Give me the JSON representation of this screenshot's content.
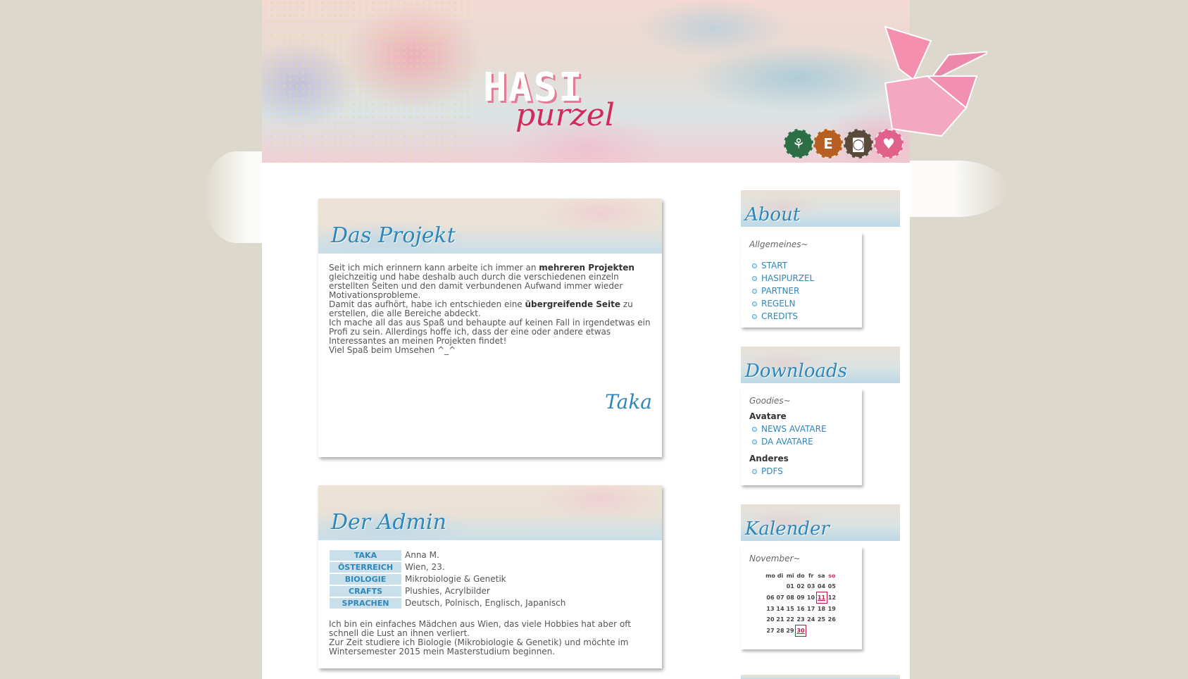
{
  "header": {
    "logo_top": "HASI",
    "logo_bottom": "purzel",
    "social": [
      {
        "icon": "deviantart-icon",
        "glyph": "⚘",
        "color": "#2e6e44"
      },
      {
        "icon": "etsy-icon",
        "glyph": "E",
        "color": "#b75f22"
      },
      {
        "icon": "instagram-icon",
        "glyph": "◙",
        "color": "#5a4a3a"
      },
      {
        "icon": "heart-icon",
        "glyph": "♥",
        "color": "#e0628a"
      }
    ]
  },
  "projekt": {
    "title": "Das Projekt",
    "p1_pre": "Seit ich mich erinnern kann arbeite ich immer an ",
    "p1_bold": "mehreren Projekten",
    "p1_post": " gleichzeitig und habe deshalb auch durch die verschiedenen einzeln erstellten Seiten und den damit verbundenen Aufwand immer wieder Motivationsprobleme.",
    "p2_pre": "Damit das aufhört, habe ich entschieden eine ",
    "p2_bold": "übergreifende Seite",
    "p2_post": " zu erstellen, die alle Bereiche abdeckt.",
    "p3": "Ich mache all das aus Spaß und behaupte auf keinen Fall in irgendetwas ein Profi zu sein. Allerdings hoffe ich, dass der eine oder andere etwas Interessantes an meinen Projekten findet!",
    "p4": "Viel Spaß beim Umsehen ^_^",
    "signature": "Taka"
  },
  "admin": {
    "title": "Der Admin",
    "rows": [
      {
        "key": "TAKA",
        "value": "Anna M."
      },
      {
        "key": "ÖSTERREICH",
        "value": "Wien, 23."
      },
      {
        "key": "BIOLOGIE",
        "value": "Mikrobiologie & Genetik"
      },
      {
        "key": "CRAFTS",
        "value": "Plushies, Acrylbilder"
      },
      {
        "key": "SPRACHEN",
        "value": "Deutsch, Polnisch, Englisch, Japanisch"
      }
    ],
    "p1": "Ich bin ein einfaches Mädchen aus Wien, das viele Hobbies hat aber oft schnell die Lust an ihnen verliert.",
    "p2": "Zur Zeit studiere ich Biologie (Mikrobiologie & Genetik) und möchte im Wintersemester 2015 mein Masterstudium beginnen."
  },
  "about": {
    "title": "About",
    "subtitle": "Allgemeines~",
    "links": [
      "START",
      "HASIPURZEL",
      "PARTNER",
      "REGELN",
      "CREDITS"
    ]
  },
  "downloads": {
    "title": "Downloads",
    "subtitle": "Goodies~",
    "group1": "Avatare",
    "group1_links": [
      "NEWS AVATARE",
      "DA AVATARE"
    ],
    "group2": "Anderes",
    "group2_links": [
      "PDFS"
    ]
  },
  "kalender": {
    "title": "Kalender",
    "month": "November~",
    "weekdays": [
      "mo",
      "di",
      "mi",
      "do",
      "fr",
      "sa",
      "so"
    ],
    "weeks": [
      [
        "",
        "",
        "01",
        "02",
        "03",
        "04",
        "05"
      ],
      [
        "06",
        "07",
        "08",
        "09",
        "10",
        "11",
        "12"
      ],
      [
        "13",
        "14",
        "15",
        "16",
        "17",
        "18",
        "19"
      ],
      [
        "20",
        "21",
        "22",
        "23",
        "24",
        "25",
        "26"
      ],
      [
        "27",
        "28",
        "29",
        "30",
        "",
        "",
        ""
      ]
    ],
    "marked_days": [
      "11",
      "30"
    ]
  }
}
